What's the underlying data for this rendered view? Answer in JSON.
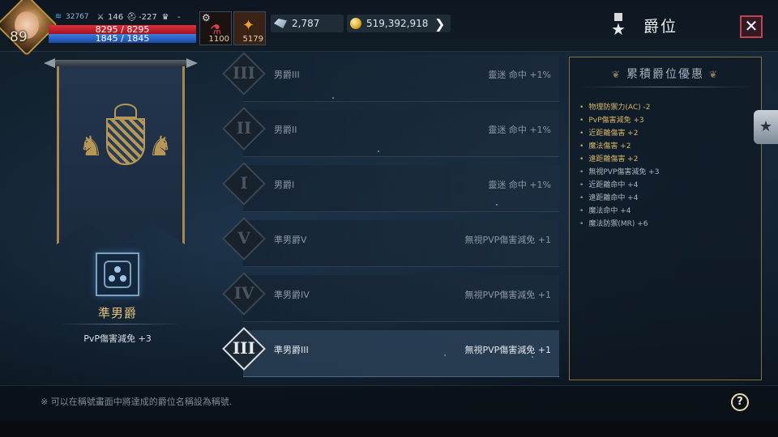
{
  "player": {
    "level": "89",
    "combat_power": "32767",
    "stat_attack": "146",
    "stat_defense": "-227",
    "stat_trophy": "-",
    "hp": "8295 / 8295",
    "mp": "1845 / 1845"
  },
  "items": {
    "potion_count": "1100",
    "scroll_count": "5179"
  },
  "currency": {
    "gems": "2,787",
    "gold": "519,392,918"
  },
  "header": {
    "title": "爵位",
    "close_label": "✕"
  },
  "current": {
    "rank_name": "準男爵",
    "bonus": "PvP傷害減免 +3"
  },
  "ranks": [
    {
      "numeral": "III",
      "name": "男爵III",
      "effect": "靈迷 命中 +1%",
      "selected": false
    },
    {
      "numeral": "II",
      "name": "男爵II",
      "effect": "靈迷 命中 +1%",
      "selected": false
    },
    {
      "numeral": "I",
      "name": "男爵I",
      "effect": "靈迷 命中 +1%",
      "selected": false
    },
    {
      "numeral": "V",
      "name": "準男爵V",
      "effect": "無視PVP傷害減免 +1",
      "selected": false
    },
    {
      "numeral": "IV",
      "name": "準男爵IV",
      "effect": "無視PVP傷害減免 +1",
      "selected": false
    },
    {
      "numeral": "III",
      "name": "準男爵III",
      "effect": "無視PVP傷害減免 +1",
      "selected": true
    }
  ],
  "benefits": {
    "title": "累積爵位優惠",
    "items": [
      {
        "text": "物理防禦力(AC) -2",
        "active": true
      },
      {
        "text": "PvP傷害減免 +3",
        "active": true
      },
      {
        "text": "近距離傷害 +2",
        "active": true
      },
      {
        "text": "魔法傷害 +2",
        "active": true
      },
      {
        "text": "遠距離傷害 +2",
        "active": true
      },
      {
        "text": "無視PVP傷害減免 +3",
        "active": false
      },
      {
        "text": "近距離命中 +4",
        "active": false
      },
      {
        "text": "遠距離命中 +4",
        "active": false
      },
      {
        "text": "魔法命中 +4",
        "active": false
      },
      {
        "text": "魔法防禦(MR) +6",
        "active": false
      }
    ]
  },
  "footer": {
    "note": "※ 可以在稱號畫面中將達成的爵位名稱設為稱號.",
    "help_label": "?"
  },
  "colors": {
    "gold_accent": "#d7b56a",
    "hp": "#c41e28",
    "mp": "#2a62c8",
    "close": "#c04550"
  }
}
